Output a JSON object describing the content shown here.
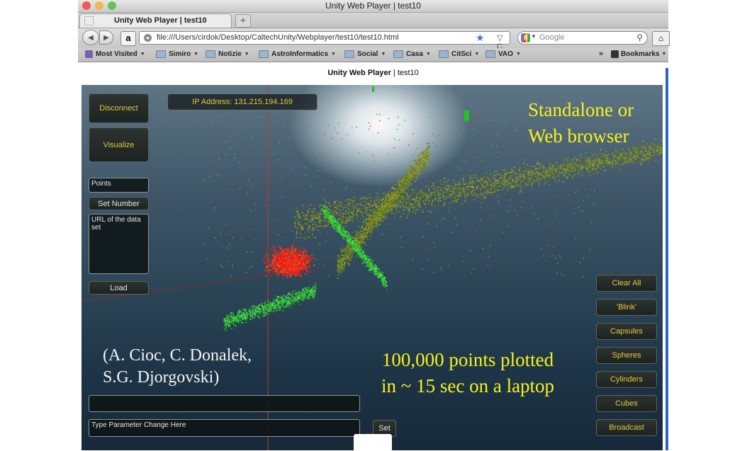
{
  "window": {
    "title": "Unity Web Player | test10",
    "traffic_light_colors": [
      "#ee5b50",
      "#f1b84a",
      "#61c554"
    ]
  },
  "tab": {
    "label": "Unity Web Player | test10",
    "new_tab_symbol": "+"
  },
  "toolbar": {
    "back_icon": "back-arrow-icon",
    "forward_icon": "forward-arrow-icon",
    "amazon_glyph": "a",
    "url": "file:///Users/cirdok/Desktop/CaltechUnity/Webplayer/test10/test10.html",
    "search_placeholder": "Google",
    "search_engine_glyph": "8"
  },
  "bookmarks": {
    "items": [
      {
        "label": "Most Visited"
      },
      {
        "label": "Simiro"
      },
      {
        "label": "Notizie"
      },
      {
        "label": "AstroInformatics"
      },
      {
        "label": "Social"
      },
      {
        "label": "Casa"
      },
      {
        "label": "CitSci"
      },
      {
        "label": "VAO"
      }
    ],
    "overflow": "»",
    "right_label": "Bookmarks"
  },
  "page": {
    "title_bold": "Unity Web Player",
    "title_rest": " | test10"
  },
  "unity": {
    "ip_address": "IP Address: 131.215.194.169",
    "disconnect_label": "Disconnect",
    "visualize_label": "Visualize",
    "points_field": "Points",
    "set_number_label": "Set Number",
    "url_field_placeholder": "URL of the data set",
    "load_label": "Load",
    "right_buttons": [
      "Clear All",
      "'Blink'",
      "Capsules",
      "Spheres",
      "Cylinders",
      "Cubes",
      "Broadcast"
    ],
    "command_field_value": "",
    "param_field_placeholder": "Type Parameter Change Here",
    "set_label": "Set",
    "accent_color": "#e3c93a"
  },
  "overlays": {
    "standalone_line1": "Standalone or",
    "standalone_line2": "Web browser",
    "points_line1": "100,000 points plotted",
    "points_line2": "in ~ 15 sec on a laptop",
    "credit_line1": "(A. Cioc, C. Donalek,",
    "credit_line2": "S.G. Djorgovski)",
    "highlight_color": "#f7f21c"
  }
}
